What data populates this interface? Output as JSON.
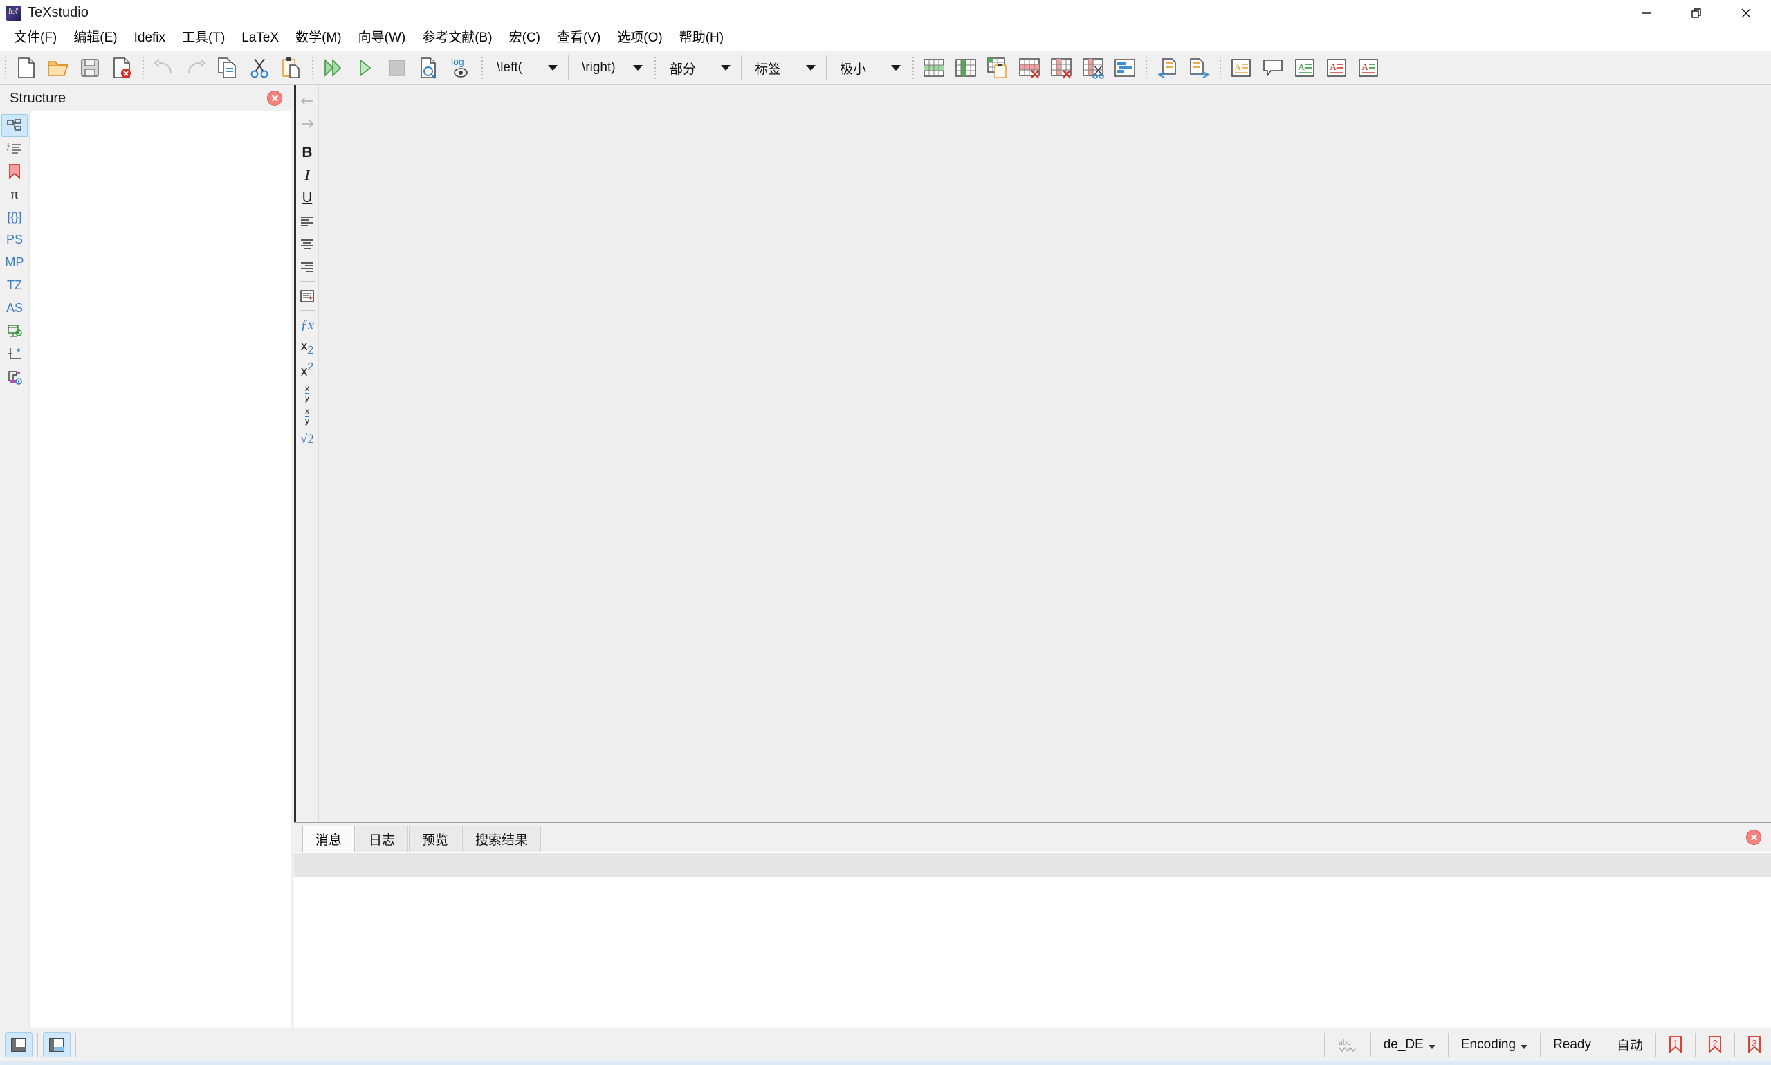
{
  "window": {
    "title": "TeXstudio",
    "icon": "texstudio-logo",
    "controls": [
      {
        "name": "minimize",
        "glyph": "minimize-icon"
      },
      {
        "name": "restore",
        "glyph": "restore-icon"
      },
      {
        "name": "close",
        "glyph": "close-icon"
      }
    ]
  },
  "menubar": {
    "items": [
      {
        "label": "文件(F)",
        "accel": "F"
      },
      {
        "label": "编辑(E)",
        "accel": "E"
      },
      {
        "label": "Idefix",
        "accel": "I"
      },
      {
        "label": "工具(T)",
        "accel": "T"
      },
      {
        "label": "LaTeX",
        "accel": "L"
      },
      {
        "label": "数学(M)",
        "accel": "M"
      },
      {
        "label": "向导(W)",
        "accel": "W"
      },
      {
        "label": "参考文献(B)",
        "accel": "B"
      },
      {
        "label": "宏(C)",
        "accel": "C"
      },
      {
        "label": "查看(V)",
        "accel": "V"
      },
      {
        "label": "选项(O)",
        "accel": "O"
      },
      {
        "label": "帮助(H)",
        "accel": "H"
      }
    ]
  },
  "toolbar": {
    "groups": [
      {
        "name": "file-group",
        "buttons": [
          {
            "icon": "new-file-icon",
            "label": "新建"
          },
          {
            "icon": "open-folder-icon",
            "label": "打开"
          },
          {
            "icon": "save-icon",
            "label": "保存"
          },
          {
            "icon": "close-file-icon",
            "label": "关闭"
          }
        ]
      },
      {
        "name": "edit-group",
        "buttons": [
          {
            "icon": "undo-icon",
            "label": "撤销",
            "disabled": true
          },
          {
            "icon": "redo-icon",
            "label": "重做",
            "disabled": true
          },
          {
            "icon": "copy-icon",
            "label": "复制"
          },
          {
            "icon": "cut-icon",
            "label": "剪切"
          },
          {
            "icon": "paste-icon",
            "label": "粘贴"
          }
        ]
      },
      {
        "name": "build-group",
        "buttons": [
          {
            "icon": "build-and-view-icon",
            "label": "编译并查看"
          },
          {
            "icon": "compile-icon",
            "label": "编译"
          },
          {
            "icon": "stop-icon",
            "label": "停止",
            "disabled": true
          },
          {
            "icon": "view-pdf-icon",
            "label": "查看PDF"
          },
          {
            "icon": "view-log-icon",
            "label": "查看日志"
          }
        ]
      },
      {
        "name": "delimiter-group",
        "combos": [
          {
            "name": "left-delimiter-combo",
            "value": "\\left("
          },
          {
            "name": "right-delimiter-combo",
            "value": "\\right)"
          }
        ]
      },
      {
        "name": "structure-group",
        "combos": [
          {
            "name": "section-combo",
            "value": "部分"
          },
          {
            "name": "label-combo",
            "value": "标签"
          },
          {
            "name": "fontsize-combo",
            "value": "极小"
          }
        ]
      },
      {
        "name": "table-group",
        "buttons": [
          {
            "icon": "add-row-icon",
            "label": "添加行"
          },
          {
            "icon": "add-column-icon",
            "label": "添加列"
          },
          {
            "icon": "paste-table-icon",
            "label": "粘贴表格"
          },
          {
            "icon": "delete-row-icon",
            "label": "删除行"
          },
          {
            "icon": "delete-column-icon",
            "label": "删除列"
          },
          {
            "icon": "cut-column-icon",
            "label": "剪切列"
          },
          {
            "icon": "align-table-icon",
            "label": "对齐表格"
          }
        ]
      },
      {
        "name": "diff-group",
        "buttons": [
          {
            "icon": "prev-change-icon",
            "label": "上一处修改"
          },
          {
            "icon": "next-change-icon",
            "label": "下一处修改"
          }
        ]
      },
      {
        "name": "annotation-group",
        "buttons": [
          {
            "icon": "highlight-orange-icon",
            "label": "标注"
          },
          {
            "icon": "comment-icon",
            "label": "注释"
          },
          {
            "icon": "highlight-green-icon",
            "label": "插入"
          },
          {
            "icon": "highlight-red-icon",
            "label": "删除"
          },
          {
            "icon": "highlight-replace-icon",
            "label": "替换"
          }
        ]
      }
    ]
  },
  "structure": {
    "title": "Structure",
    "close_label": "关闭面板",
    "side_tabs": [
      {
        "name": "structure-tab",
        "glyph": "tree-icon",
        "active": true
      },
      {
        "name": "toc-tab",
        "glyph": "numbered-list-icon",
        "active": false
      },
      {
        "name": "bookmarks-tab",
        "glyph": "bookmark-icon",
        "active": false
      },
      {
        "name": "symbols-pi-tab",
        "glyph": "pi-symbol",
        "label": "π",
        "active": false
      },
      {
        "name": "symbols-braces-tab",
        "glyph": "braces-symbol",
        "label": "{}",
        "active": false
      },
      {
        "name": "ps-tab",
        "glyph": "ps-label",
        "label": "PS",
        "active": false
      },
      {
        "name": "mp-tab",
        "glyph": "mp-label",
        "label": "MP",
        "active": false
      },
      {
        "name": "tz-tab",
        "glyph": "tz-label",
        "label": "TZ",
        "active": false
      },
      {
        "name": "as-tab",
        "glyph": "as-label",
        "label": "AS",
        "active": false
      },
      {
        "name": "presentation-tab",
        "glyph": "slideshow-icon",
        "active": false
      },
      {
        "name": "axis-tab",
        "glyph": "axis-plus-icon",
        "active": false
      },
      {
        "name": "pgf-tab",
        "glyph": "pgf-icon",
        "active": false
      }
    ],
    "tree_items": []
  },
  "format_toolbar": {
    "buttons": [
      {
        "name": "back-button",
        "glyph": "arrow-left-icon",
        "label": "←",
        "disabled": true
      },
      {
        "name": "forward-button",
        "glyph": "arrow-right-icon",
        "label": "→",
        "disabled": true
      },
      {
        "name": "bold-button",
        "glyph": "bold-icon",
        "label": "B"
      },
      {
        "name": "italic-button",
        "glyph": "italic-icon",
        "label": "I"
      },
      {
        "name": "underline-button",
        "glyph": "underline-icon",
        "label": "U"
      },
      {
        "name": "align-left-button",
        "glyph": "align-left-icon"
      },
      {
        "name": "align-center-button",
        "glyph": "align-center-icon"
      },
      {
        "name": "align-right-button",
        "glyph": "align-right-icon"
      },
      {
        "name": "newline-button",
        "glyph": "newline-icon"
      },
      {
        "name": "function-button",
        "glyph": "fx-icon",
        "label": "ƒx"
      },
      {
        "name": "subscript-button",
        "glyph": "subscript-icon",
        "label": "x₂"
      },
      {
        "name": "superscript-button",
        "glyph": "superscript-icon",
        "label": "x²"
      },
      {
        "name": "inline-fraction-button",
        "glyph": "fraction-icon",
        "label": "x/y"
      },
      {
        "name": "display-fraction-button",
        "glyph": "dfraction-icon",
        "label": "x/y"
      },
      {
        "name": "sqrt-button",
        "glyph": "sqrt-icon",
        "label": "√2"
      }
    ]
  },
  "editor": {
    "content": "",
    "placeholder": ""
  },
  "output_panel": {
    "tabs": [
      {
        "label": "消息",
        "active": true
      },
      {
        "label": "日志",
        "active": false
      },
      {
        "label": "预览",
        "active": false
      },
      {
        "label": "搜索结果",
        "active": false
      }
    ],
    "close_label": "关闭输出面板",
    "content": ""
  },
  "statusbar": {
    "left_toggles": [
      {
        "name": "toggle-structure-view",
        "glyph": "panel-left-icon",
        "active": true
      },
      {
        "name": "toggle-output-view",
        "glyph": "panel-bottom-icon",
        "active": true
      }
    ],
    "spellcheck_icon": "abc-spellcheck-icon",
    "spellcheck_label": "abc",
    "language": "de_DE",
    "encoding": "Encoding",
    "state": "Ready",
    "line_ending": "自动",
    "bookmarks": [
      {
        "number": "1",
        "color": "#d03a3a"
      },
      {
        "number": "2",
        "color": "#d03a3a"
      },
      {
        "number": "3",
        "color": "#d03a3a"
      }
    ]
  },
  "colors": {
    "window_bg": "#efefef",
    "toolbar_bg": "#f0f0f0",
    "panel_white": "#ffffff",
    "accent_blue": "#3b7fc4",
    "active_tab_blue": "#cde8fa",
    "close_red": "#f4827f",
    "green": "#4caf50",
    "orange": "#f0a030",
    "red": "#e04040"
  }
}
